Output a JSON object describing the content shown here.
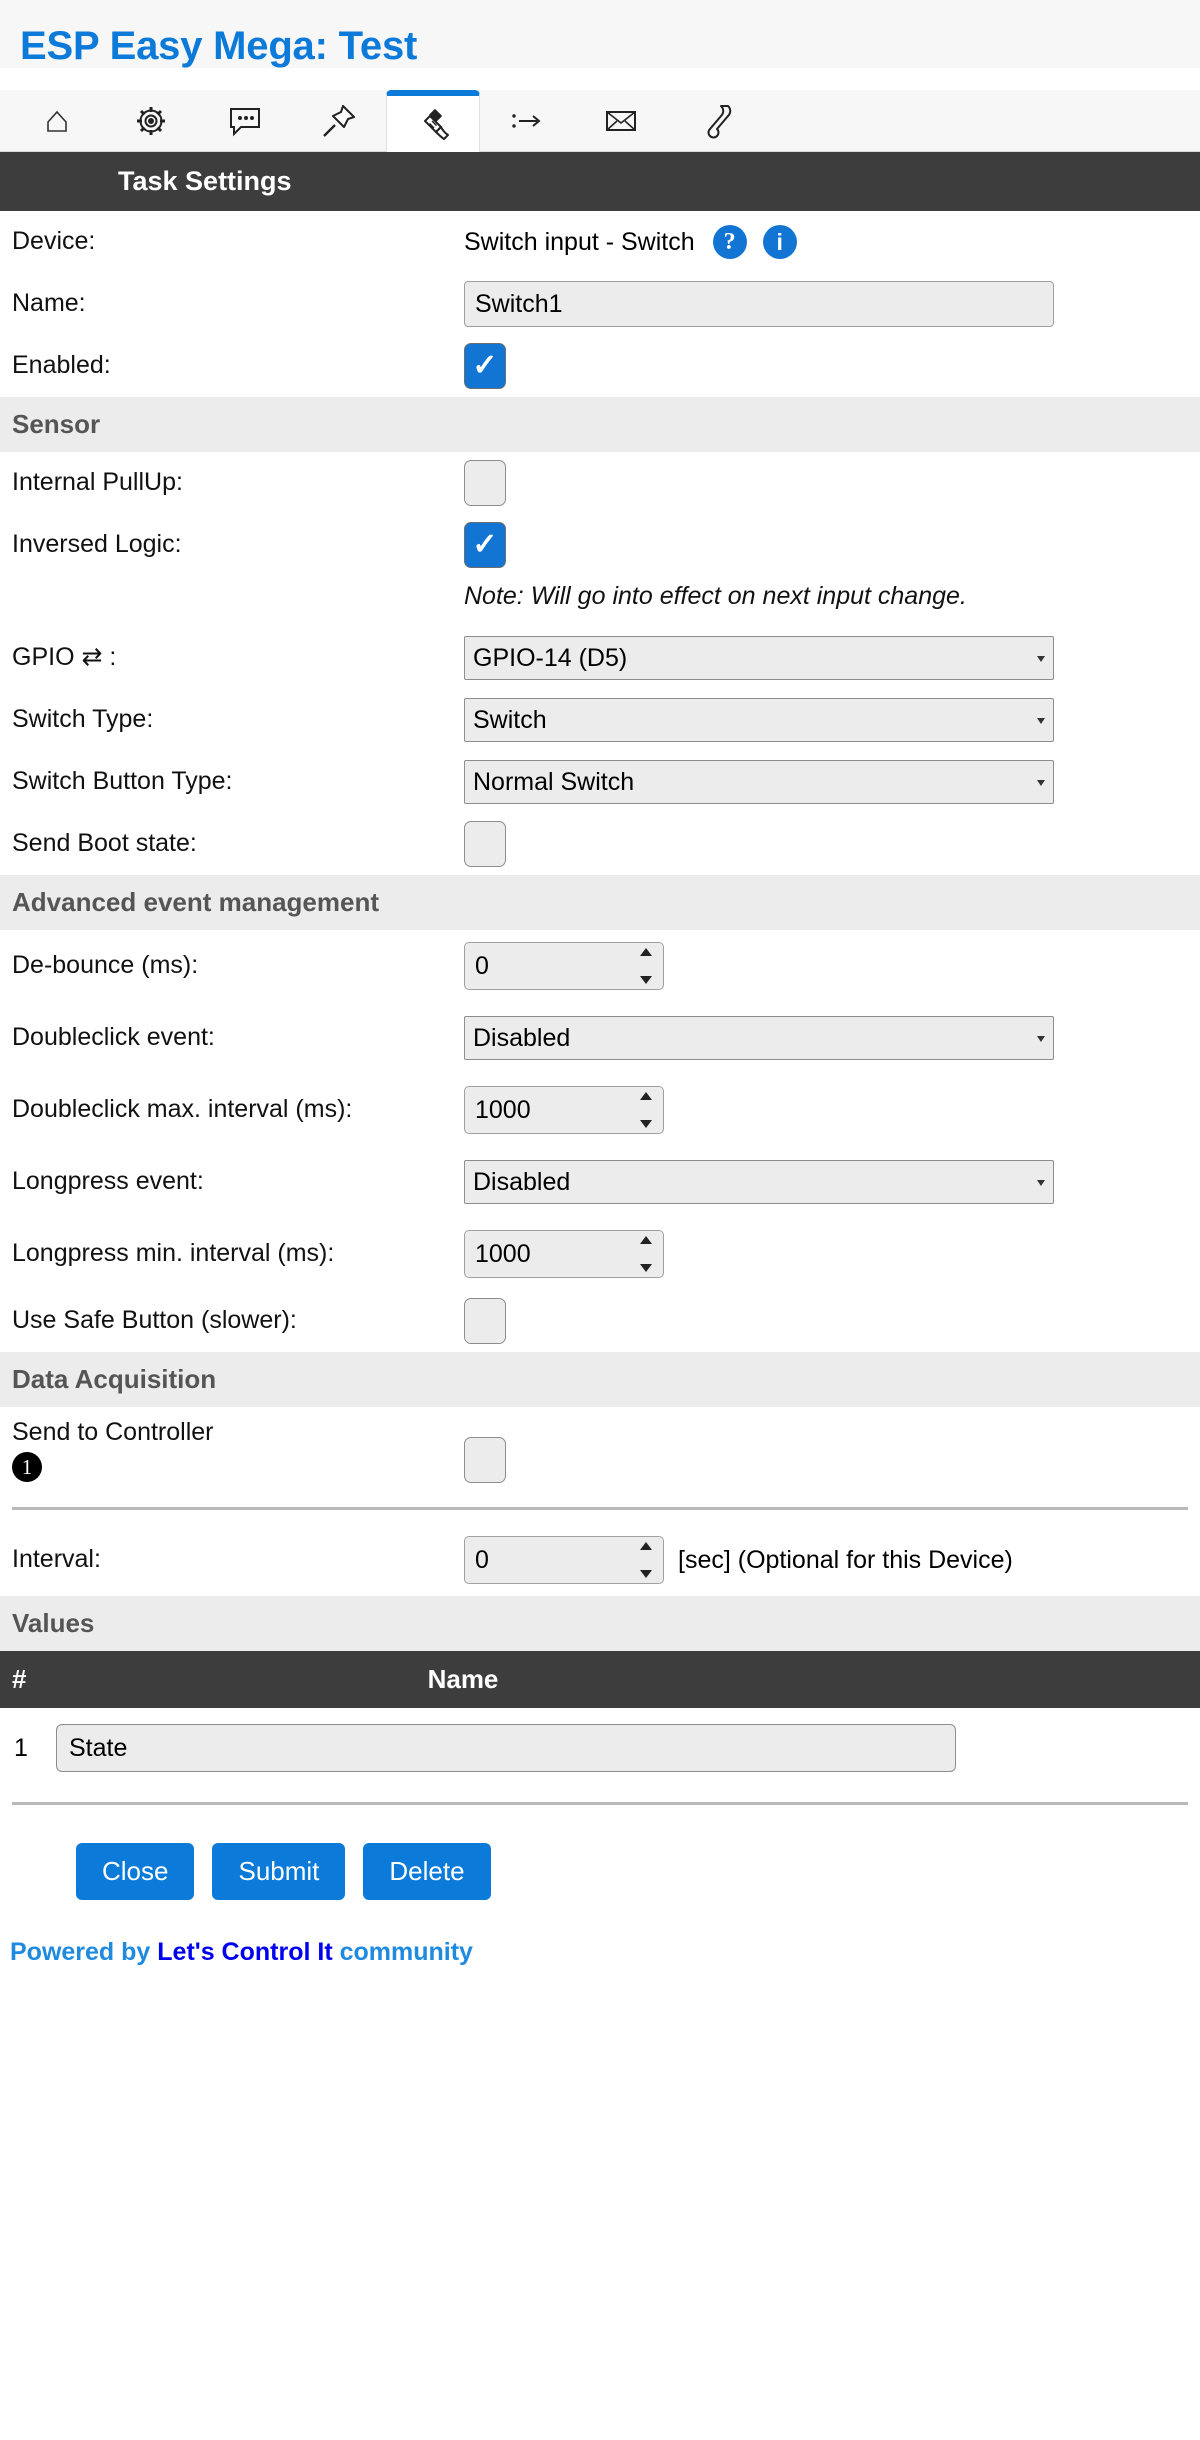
{
  "header": {
    "title": "ESP Easy Mega: Test",
    "accent_color": "#0b7ad8"
  },
  "tabs": [
    {
      "name": "home",
      "icon": "home-icon",
      "active": false
    },
    {
      "name": "config",
      "icon": "gear-icon",
      "active": false
    },
    {
      "name": "controllers",
      "icon": "chat-icon",
      "active": false
    },
    {
      "name": "hardware",
      "icon": "pin-icon",
      "active": false
    },
    {
      "name": "devices",
      "icon": "plug-icon",
      "active": true
    },
    {
      "name": "rules",
      "icon": "rules-arrow-icon",
      "active": false
    },
    {
      "name": "notifications",
      "icon": "mail-icon",
      "active": false
    },
    {
      "name": "tools",
      "icon": "wrench-icon",
      "active": false
    }
  ],
  "section_task": {
    "title": "Task Settings",
    "device_label": "Device:",
    "device_value": "Switch input - Switch",
    "help_icon": "?",
    "info_icon": "i",
    "name_label": "Name:",
    "name_value": "Switch1",
    "enabled_label": "Enabled:",
    "enabled_checked": true
  },
  "section_sensor": {
    "title": "Sensor",
    "pullup_label": "Internal PullUp:",
    "pullup_checked": false,
    "inversed_label": "Inversed Logic:",
    "inversed_checked": true,
    "note": "Note: Will go into effect on next input change.",
    "gpio_label": "GPIO ⇄ :",
    "gpio_value": "GPIO-14 (D5)",
    "switch_type_label": "Switch Type:",
    "switch_type_value": "Switch",
    "switch_button_type_label": "Switch Button Type:",
    "switch_button_type_value": "Normal Switch",
    "send_boot_label": "Send Boot state:",
    "send_boot_checked": false
  },
  "section_advanced": {
    "title": "Advanced event management",
    "debounce_label": "De-bounce (ms):",
    "debounce_value": "0",
    "doubleclick_label": "Doubleclick event:",
    "doubleclick_value": "Disabled",
    "doubleclick_interval_label": "Doubleclick max. interval (ms):",
    "doubleclick_interval_value": "1000",
    "longpress_label": "Longpress event:",
    "longpress_value": "Disabled",
    "longpress_interval_label": "Longpress min. interval (ms):",
    "longpress_interval_value": "1000",
    "safe_button_label": "Use Safe Button (slower):",
    "safe_button_checked": false
  },
  "section_data": {
    "title": "Data Acquisition",
    "send_controller_label": "Send to Controller",
    "controller_badge": "1",
    "send_controller_checked": false,
    "interval_label": "Interval:",
    "interval_value": "0",
    "interval_unit": "[sec] (Optional for this Device)"
  },
  "section_values": {
    "title": "Values",
    "columns": [
      "#",
      "Name"
    ],
    "rows": [
      {
        "num": "1",
        "name": "State"
      }
    ]
  },
  "buttons": {
    "close": "Close",
    "submit": "Submit",
    "delete": "Delete"
  },
  "footer": {
    "prefix": "Powered by ",
    "link": "Let's Control It",
    "suffix": " community"
  }
}
